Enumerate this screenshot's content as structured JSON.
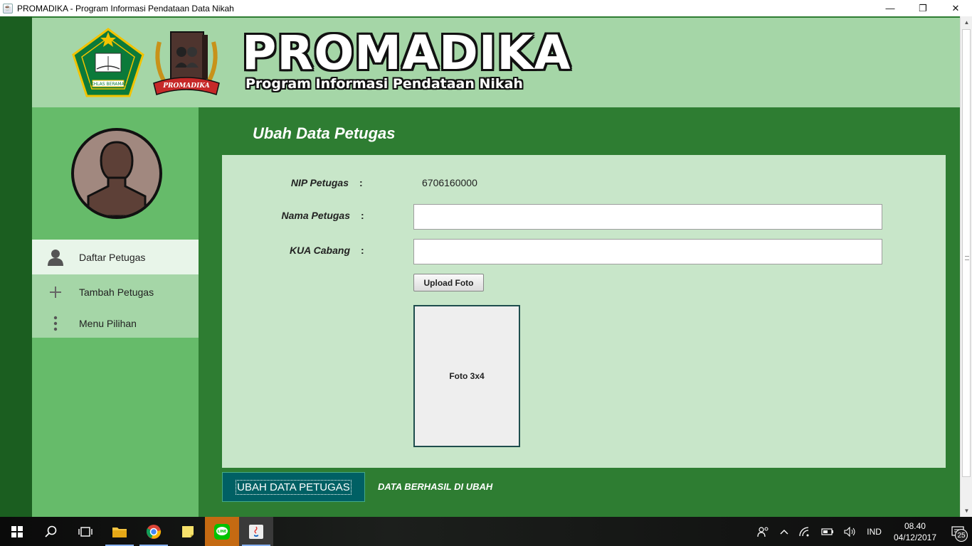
{
  "window": {
    "title": "PROMADIKA - Program Informasi Pendataan Data Nikah",
    "minimize": "—",
    "restore": "❐",
    "close": "✕"
  },
  "header": {
    "brand_title": "PROMADIKA",
    "brand_subtitle": "Program Informasi Pendataan Nikah",
    "kemenag_logo_text": "IKHLAS BERAMAL",
    "promadika_logo_text": "PROMADIKA"
  },
  "sidebar": {
    "items": [
      {
        "label": "Daftar Petugas",
        "icon": "person-icon",
        "active": true
      },
      {
        "label": "Tambah Petugas",
        "icon": "plus-icon",
        "active": false
      },
      {
        "label": "Menu Pilihan",
        "icon": "more-vertical-icon",
        "active": false
      }
    ]
  },
  "main": {
    "heading": "Ubah Data Petugas",
    "form": {
      "nip_label": "NIP Petugas",
      "nip_value": "6706160000",
      "nama_label": "Nama Petugas",
      "nama_value": "",
      "kua_label": "KUA Cabang",
      "kua_value": "",
      "colon": ":",
      "upload_label": "Upload Foto",
      "photo_placeholder": "Foto 3x4"
    },
    "submit_label": "UBAH DATA PETUGAS",
    "status_message": "DATA BERHASIL DI UBAH"
  },
  "taskbar": {
    "language": "IND",
    "time": "08.40",
    "date": "04/12/2017",
    "notification_count": "25"
  },
  "colors": {
    "dark_green": "#1b5e20",
    "green": "#2e7d32",
    "light_green": "#a5d6a7",
    "panel_green": "#c8e6c9",
    "side_green": "#66bb6a",
    "teal_button": "#006064"
  }
}
